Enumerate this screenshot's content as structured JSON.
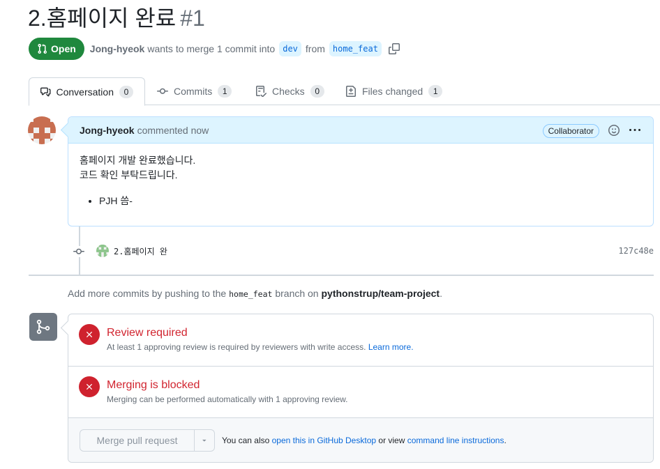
{
  "pr": {
    "title": "2.홈페이지 완료",
    "number": "#1",
    "state": "Open",
    "author": "Jong-hyeok",
    "action_text": "wants to merge 1 commit into",
    "base_branch": "dev",
    "from_text": "from",
    "head_branch": "home_feat"
  },
  "tabs": [
    {
      "label": "Conversation",
      "count": "0"
    },
    {
      "label": "Commits",
      "count": "1"
    },
    {
      "label": "Checks",
      "count": "0"
    },
    {
      "label": "Files changed",
      "count": "1"
    }
  ],
  "comment": {
    "author": "Jong-hyeok",
    "time": "commented now",
    "badge": "Collaborator",
    "line1": "홈페이지 개발 완료했습니다.",
    "line2": "코드 확인 부탁드립니다.",
    "bullet": "PJH 씀-"
  },
  "commit": {
    "message": "2.홈페이지 완",
    "sha": "127c48e"
  },
  "push_note": {
    "prefix": "Add more commits by pushing to the",
    "branch": "home_feat",
    "middle": "branch on",
    "repo": "pythonstrup/team-project",
    "suffix": "."
  },
  "merge": {
    "review_title": "Review required",
    "review_sub": "At least 1 approving review is required by reviewers with write access.",
    "learn_more": "Learn more.",
    "blocked_title": "Merging is blocked",
    "blocked_sub": "Merging can be performed automatically with 1 approving review.",
    "button_label": "Merge pull request",
    "hint_prefix": "You can also",
    "hint_link1": "open this in GitHub Desktop",
    "hint_middle": "or view",
    "hint_link2": "command line instructions",
    "hint_suffix": "."
  },
  "colors": {
    "open_green": "#1f883d",
    "link_blue": "#0969da",
    "danger_red": "#cf222e",
    "comment_header": "#ddf4ff"
  },
  "icons": [
    "git-pull-request-icon",
    "copy-icon",
    "comment-discussion-icon",
    "git-commit-icon",
    "checklist-icon",
    "file-diff-icon",
    "smiley-icon",
    "kebab-horizontal-icon",
    "git-merge-icon",
    "x-icon",
    "triangle-down-icon"
  ]
}
